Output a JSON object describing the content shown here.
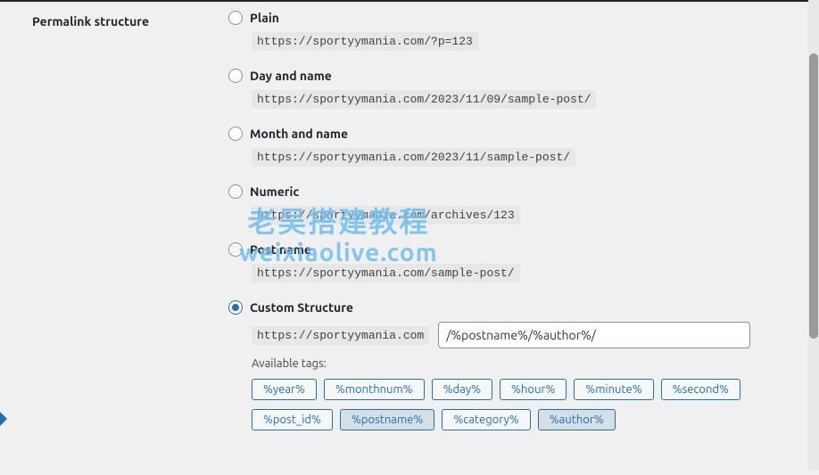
{
  "section_title": "Permalink structure",
  "options": {
    "plain": {
      "label": "Plain",
      "example": "https://sportyymania.com/?p=123"
    },
    "dayname": {
      "label": "Day and name",
      "example": "https://sportyymania.com/2023/11/09/sample-post/"
    },
    "monthname": {
      "label": "Month and name",
      "example": "https://sportyymania.com/2023/11/sample-post/"
    },
    "numeric": {
      "label": "Numeric",
      "example": "https://sportyymania.com/archives/123"
    },
    "postname": {
      "label": "Post name",
      "example": "https://sportyymania.com/sample-post/"
    },
    "custom": {
      "label": "Custom Structure",
      "base": "https://sportyymania.com",
      "value": "/%postname%/%author%/"
    }
  },
  "available_tags_label": "Available tags:",
  "tags_row1": [
    "%year%",
    "%monthnum%",
    "%day%",
    "%hour%",
    "%minute%",
    "%second%"
  ],
  "tags_row2": [
    "%post_id%",
    "%postname%",
    "%category%",
    "%author%"
  ],
  "active_tags": [
    "%postname%",
    "%author%"
  ],
  "watermark": {
    "cn": "老吴搭建教程",
    "en": "weixiaolive.com"
  }
}
